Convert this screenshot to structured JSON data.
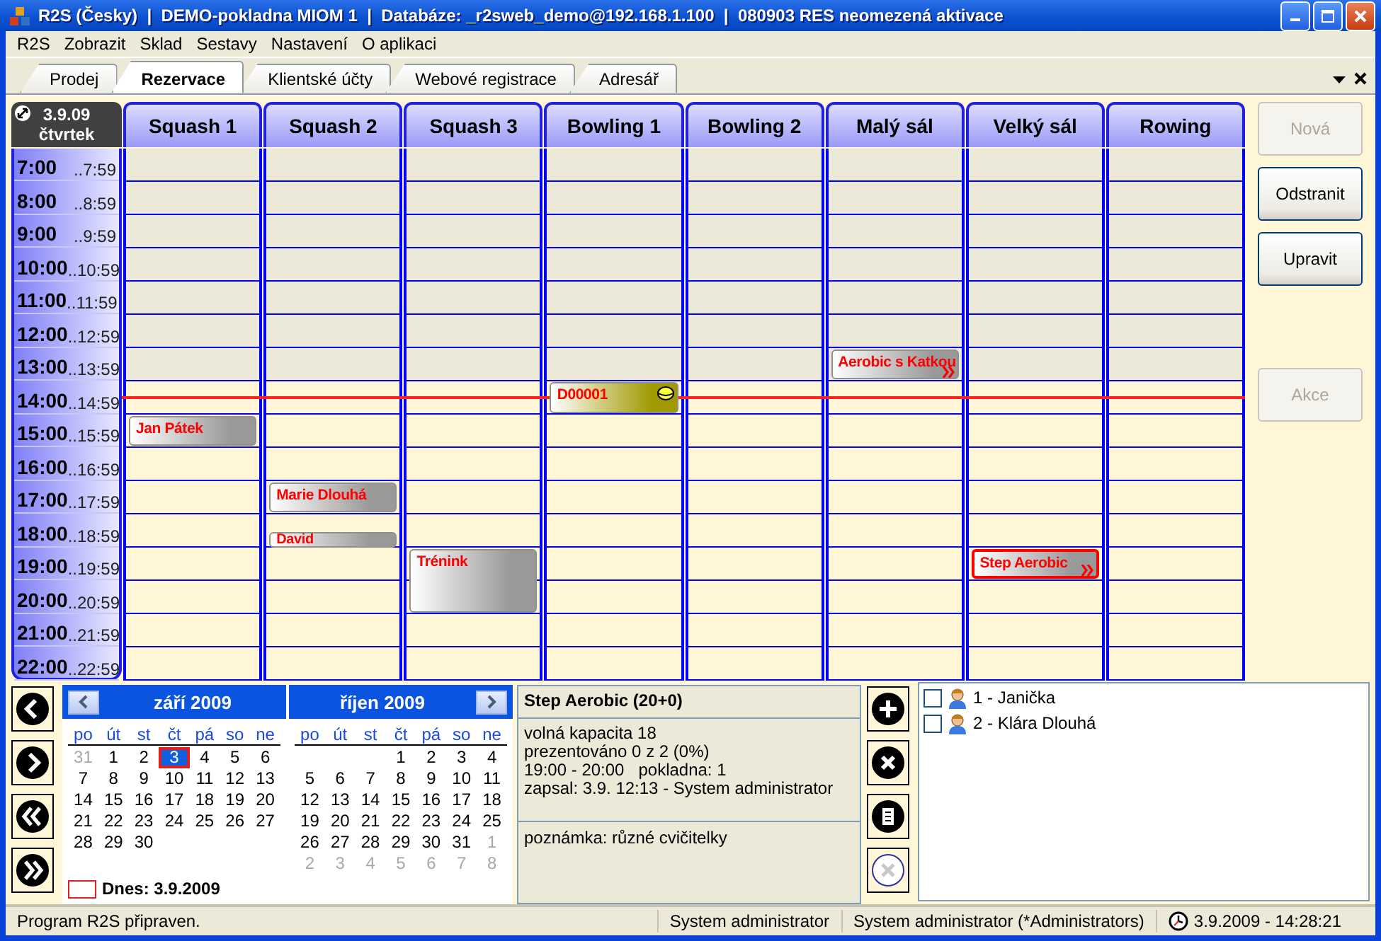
{
  "window": {
    "title": "R2S (Česky)  |  DEMO-pokladna MIOM 1  |  Databáze: _r2sweb_demo@192.168.1.100  |  080903 RES neomezená aktivace"
  },
  "menu": [
    "R2S",
    "Zobrazit",
    "Sklad",
    "Sestavy",
    "Nastavení",
    "O aplikaci"
  ],
  "tabs": [
    {
      "label": "Prodej",
      "selected": false
    },
    {
      "label": "Rezervace",
      "selected": true
    },
    {
      "label": "Klientské účty",
      "selected": false
    },
    {
      "label": "Webové registrace",
      "selected": false
    },
    {
      "label": "Adresář",
      "selected": false
    }
  ],
  "schedule": {
    "date": "3.9.09",
    "weekday": "čtvrtek",
    "hours": [
      {
        "start": "7:00",
        "end": "..7:59"
      },
      {
        "start": "8:00",
        "end": "..8:59"
      },
      {
        "start": "9:00",
        "end": "..9:59"
      },
      {
        "start": "10:00",
        "end": "..10:59"
      },
      {
        "start": "11:00",
        "end": "..11:59"
      },
      {
        "start": "12:00",
        "end": "..12:59"
      },
      {
        "start": "13:00",
        "end": "..13:59"
      },
      {
        "start": "14:00",
        "end": "..14:59"
      },
      {
        "start": "15:00",
        "end": "..15:59"
      },
      {
        "start": "16:00",
        "end": "..16:59"
      },
      {
        "start": "17:00",
        "end": "..17:59"
      },
      {
        "start": "18:00",
        "end": "..18:59"
      },
      {
        "start": "19:00",
        "end": "..19:59"
      },
      {
        "start": "20:00",
        "end": "..20:59"
      },
      {
        "start": "21:00",
        "end": "..21:59"
      },
      {
        "start": "22:00",
        "end": "..22:59"
      }
    ],
    "resources": [
      {
        "name": "Squash 1",
        "slots": [
          {
            "kind": "free"
          },
          {
            "kind": "free"
          },
          {
            "kind": "free"
          },
          {
            "kind": "free"
          },
          {
            "kind": "free"
          },
          {
            "kind": "free"
          },
          {
            "kind": "free"
          },
          {
            "kind": "free"
          },
          {
            "kind": "booking",
            "title": "Jan Pátek",
            "color": "#999999",
            "selected": false,
            "half": false,
            "coin": false,
            "chevrons": false
          },
          {
            "kind": "free"
          },
          {
            "kind": "free"
          },
          {
            "kind": "free"
          },
          {
            "kind": "free"
          },
          {
            "kind": "free"
          },
          {
            "kind": "free"
          },
          {
            "kind": "free"
          }
        ]
      },
      {
        "name": "Squash 2",
        "slots": [
          {
            "kind": "free"
          },
          {
            "kind": "free"
          },
          {
            "kind": "free"
          },
          {
            "kind": "free"
          },
          {
            "kind": "free"
          },
          {
            "kind": "free"
          },
          {
            "kind": "free"
          },
          {
            "kind": "free"
          },
          {
            "kind": "free"
          },
          {
            "kind": "free"
          },
          {
            "kind": "booking",
            "title": "Marie Dlouhá",
            "color": "#999999",
            "selected": false,
            "half": false,
            "coin": false,
            "chevrons": false
          },
          {
            "kind": "booking",
            "title": "David",
            "color": "#999999",
            "selected": false,
            "half": true,
            "coin": false,
            "chevrons": false
          },
          {
            "kind": "free"
          },
          {
            "kind": "free"
          },
          {
            "kind": "free"
          },
          {
            "kind": "free"
          }
        ]
      },
      {
        "name": "Squash 3",
        "slots": [
          {
            "kind": "free"
          },
          {
            "kind": "free"
          },
          {
            "kind": "free"
          },
          {
            "kind": "free"
          },
          {
            "kind": "free"
          },
          {
            "kind": "free"
          },
          {
            "kind": "free"
          },
          {
            "kind": "free"
          },
          {
            "kind": "free"
          },
          {
            "kind": "free"
          },
          {
            "kind": "free"
          },
          {
            "kind": "free"
          },
          {
            "kind": "booking",
            "title": "Trénink",
            "color": "#999999",
            "selected": false,
            "half": false,
            "coin": false,
            "chevrons": false
          },
          {
            "kind": "continued"
          },
          {
            "kind": "free"
          },
          {
            "kind": "free"
          }
        ]
      },
      {
        "name": "Bowling 1",
        "slots": [
          {
            "kind": "free"
          },
          {
            "kind": "free"
          },
          {
            "kind": "free"
          },
          {
            "kind": "free"
          },
          {
            "kind": "free"
          },
          {
            "kind": "free"
          },
          {
            "kind": "free"
          },
          {
            "kind": "booking",
            "title": "D00001",
            "color": "#a09a00",
            "selected": false,
            "half": false,
            "coin": true,
            "chevrons": false
          },
          {
            "kind": "free"
          },
          {
            "kind": "free"
          },
          {
            "kind": "free"
          },
          {
            "kind": "free"
          },
          {
            "kind": "free"
          },
          {
            "kind": "free"
          },
          {
            "kind": "free"
          },
          {
            "kind": "free"
          }
        ]
      },
      {
        "name": "Bowling 2"
      },
      {
        "name": "Malý sál",
        "slots": [
          {
            "kind": "free"
          },
          {
            "kind": "free"
          },
          {
            "kind": "free"
          },
          {
            "kind": "free"
          },
          {
            "kind": "free"
          },
          {
            "kind": "free"
          },
          {
            "kind": "booking",
            "title": "Aerobic s Katkou",
            "color": "#999999",
            "selected": false,
            "half": false,
            "coin": false,
            "chevrons": true
          },
          {
            "kind": "free"
          },
          {
            "kind": "free"
          },
          {
            "kind": "free"
          },
          {
            "kind": "free"
          },
          {
            "kind": "free"
          },
          {
            "kind": "free"
          },
          {
            "kind": "free"
          },
          {
            "kind": "free"
          },
          {
            "kind": "free"
          }
        ]
      },
      {
        "name": "Velký sál",
        "slots": [
          {
            "kind": "free"
          },
          {
            "kind": "free"
          },
          {
            "kind": "free"
          },
          {
            "kind": "free"
          },
          {
            "kind": "free"
          },
          {
            "kind": "free"
          },
          {
            "kind": "free"
          },
          {
            "kind": "free"
          },
          {
            "kind": "free"
          },
          {
            "kind": "free"
          },
          {
            "kind": "free"
          },
          {
            "kind": "free"
          },
          {
            "kind": "booking",
            "title": "Step Aerobic",
            "color": "#999999",
            "selected": true,
            "half": false,
            "coin": false,
            "chevrons": true
          },
          {
            "kind": "free"
          },
          {
            "kind": "free"
          },
          {
            "kind": "free"
          }
        ]
      },
      {
        "name": "Rowing"
      }
    ]
  },
  "button_groups": [
    [
      {
        "label": "Nová",
        "disabled": true
      },
      {
        "label": "Odstranit",
        "disabled": false
      },
      {
        "label": "Upravit",
        "disabled": false
      }
    ],
    [
      {
        "label": "Akce",
        "disabled": true
      }
    ]
  ],
  "calendars": [
    {
      "title": "září 2009",
      "prev_button": true,
      "next_button": false,
      "weekdays": [
        "po",
        "út",
        "st",
        "čt",
        "pá",
        "so",
        "ne"
      ],
      "days": [
        {
          "kind": "day",
          "label": "31",
          "muted": true,
          "selected": false
        },
        {
          "kind": "day",
          "label": "1",
          "muted": false,
          "selected": false
        },
        {
          "kind": "day",
          "label": "2",
          "muted": false,
          "selected": false
        },
        {
          "kind": "day",
          "label": "3",
          "muted": false,
          "selected": true
        },
        {
          "kind": "day",
          "label": "4",
          "muted": false,
          "selected": false
        },
        {
          "kind": "day",
          "label": "5",
          "muted": false,
          "selected": false
        },
        {
          "kind": "day",
          "label": "6",
          "muted": false,
          "selected": false
        },
        {
          "kind": "day",
          "label": "7",
          "muted": false,
          "selected": false
        },
        {
          "kind": "day",
          "label": "8",
          "muted": false,
          "selected": false
        },
        {
          "kind": "day",
          "label": "9",
          "muted": false,
          "selected": false
        },
        {
          "kind": "day",
          "label": "10",
          "muted": false,
          "selected": false
        },
        {
          "kind": "day",
          "label": "11",
          "muted": false,
          "selected": false
        },
        {
          "kind": "day",
          "label": "12",
          "muted": false,
          "selected": false
        },
        {
          "kind": "day",
          "label": "13",
          "muted": false,
          "selected": false
        },
        {
          "kind": "day",
          "label": "14",
          "muted": false,
          "selected": false
        },
        {
          "kind": "day",
          "label": "15",
          "muted": false,
          "selected": false
        },
        {
          "kind": "day",
          "label": "16",
          "muted": false,
          "selected": false
        },
        {
          "kind": "day",
          "label": "17",
          "muted": false,
          "selected": false
        },
        {
          "kind": "day",
          "label": "18",
          "muted": false,
          "selected": false
        },
        {
          "kind": "day",
          "label": "19",
          "muted": false,
          "selected": false
        },
        {
          "kind": "day",
          "label": "20",
          "muted": false,
          "selected": false
        },
        {
          "kind": "day",
          "label": "21",
          "muted": false,
          "selected": false
        },
        {
          "kind": "day",
          "label": "22",
          "muted": false,
          "selected": false
        },
        {
          "kind": "day",
          "label": "23",
          "muted": false,
          "selected": false
        },
        {
          "kind": "day",
          "label": "24",
          "muted": false,
          "selected": false
        },
        {
          "kind": "day",
          "label": "25",
          "muted": false,
          "selected": false
        },
        {
          "kind": "day",
          "label": "26",
          "muted": false,
          "selected": false
        },
        {
          "kind": "day",
          "label": "27",
          "muted": false,
          "selected": false
        },
        {
          "kind": "day",
          "label": "28",
          "muted": false,
          "selected": false
        },
        {
          "kind": "day",
          "label": "29",
          "muted": false,
          "selected": false
        },
        {
          "kind": "day",
          "label": "30",
          "muted": false,
          "selected": false
        }
      ],
      "today": "Dnes: 3.9.2009"
    },
    {
      "title": "říjen 2009",
      "prev_button": false,
      "next_button": true,
      "weekdays": [
        "po",
        "út",
        "st",
        "čt",
        "pá",
        "so",
        "ne"
      ],
      "days": [
        {
          "kind": "blank"
        },
        {
          "kind": "blank"
        },
        {
          "kind": "blank"
        },
        {
          "kind": "day",
          "label": "1",
          "muted": false,
          "selected": false
        },
        {
          "kind": "day",
          "label": "2",
          "muted": false,
          "selected": false
        },
        {
          "kind": "day",
          "label": "3",
          "muted": false,
          "selected": false
        },
        {
          "kind": "day",
          "label": "4",
          "muted": false,
          "selected": false
        },
        {
          "kind": "day",
          "label": "5",
          "muted": false,
          "selected": false
        },
        {
          "kind": "day",
          "label": "6",
          "muted": false,
          "selected": false
        },
        {
          "kind": "day",
          "label": "7",
          "muted": false,
          "selected": false
        },
        {
          "kind": "day",
          "label": "8",
          "muted": false,
          "selected": false
        },
        {
          "kind": "day",
          "label": "9",
          "muted": false,
          "selected": false
        },
        {
          "kind": "day",
          "label": "10",
          "muted": false,
          "selected": false
        },
        {
          "kind": "day",
          "label": "11",
          "muted": false,
          "selected": false
        },
        {
          "kind": "day",
          "label": "12",
          "muted": false,
          "selected": false
        },
        {
          "kind": "day",
          "label": "13",
          "muted": false,
          "selected": false
        },
        {
          "kind": "day",
          "label": "14",
          "muted": false,
          "selected": false
        },
        {
          "kind": "day",
          "label": "15",
          "muted": false,
          "selected": false
        },
        {
          "kind": "day",
          "label": "16",
          "muted": false,
          "selected": false
        },
        {
          "kind": "day",
          "label": "17",
          "muted": false,
          "selected": false
        },
        {
          "kind": "day",
          "label": "18",
          "muted": false,
          "selected": false
        },
        {
          "kind": "day",
          "label": "19",
          "muted": false,
          "selected": false
        },
        {
          "kind": "day",
          "label": "20",
          "muted": false,
          "selected": false
        },
        {
          "kind": "day",
          "label": "21",
          "muted": false,
          "selected": false
        },
        {
          "kind": "day",
          "label": "22",
          "muted": false,
          "selected": false
        },
        {
          "kind": "day",
          "label": "23",
          "muted": false,
          "selected": false
        },
        {
          "kind": "day",
          "label": "24",
          "muted": false,
          "selected": false
        },
        {
          "kind": "day",
          "label": "25",
          "muted": false,
          "selected": false
        },
        {
          "kind": "day",
          "label": "26",
          "muted": false,
          "selected": false
        },
        {
          "kind": "day",
          "label": "27",
          "muted": false,
          "selected": false
        },
        {
          "kind": "day",
          "label": "28",
          "muted": false,
          "selected": false
        },
        {
          "kind": "day",
          "label": "29",
          "muted": false,
          "selected": false
        },
        {
          "kind": "day",
          "label": "30",
          "muted": false,
          "selected": false
        },
        {
          "kind": "day",
          "label": "31",
          "muted": false,
          "selected": false
        },
        {
          "kind": "day",
          "label": "1",
          "muted": true,
          "selected": false
        },
        {
          "kind": "day",
          "label": "2",
          "muted": true,
          "selected": false
        },
        {
          "kind": "day",
          "label": "3",
          "muted": true,
          "selected": false
        },
        {
          "kind": "day",
          "label": "4",
          "muted": true,
          "selected": false
        },
        {
          "kind": "day",
          "label": "5",
          "muted": true,
          "selected": false
        },
        {
          "kind": "day",
          "label": "6",
          "muted": true,
          "selected": false
        },
        {
          "kind": "day",
          "label": "7",
          "muted": true,
          "selected": false
        },
        {
          "kind": "day",
          "label": "8",
          "muted": true,
          "selected": false
        }
      ]
    }
  ],
  "event_info": {
    "title": "Step Aerobic (20+0)",
    "lines": [
      "volná kapacita 18",
      "prezentováno 0 z 2 (0%)",
      "19:00 - 20:00   pokladna: 1",
      "zapsal: 3.9. 12:13 - System administrator"
    ],
    "note": "poznámka: různé cvičitelky"
  },
  "actions": [
    {
      "kind": "add",
      "disabled": false
    },
    {
      "kind": "remove",
      "disabled": false
    },
    {
      "kind": "document",
      "disabled": false
    },
    {
      "kind": "cancel",
      "disabled": true
    }
  ],
  "attendees": [
    {
      "label": "1 - Janička",
      "checked": false
    },
    {
      "label": "2 - Klára Dlouhá",
      "checked": false
    }
  ],
  "status_bar": {
    "message": "Program R2S připraven.",
    "user": "System administrator",
    "role": "System administrator (*Administrators)",
    "clock": "3.9.2009 - 14:28:21"
  }
}
